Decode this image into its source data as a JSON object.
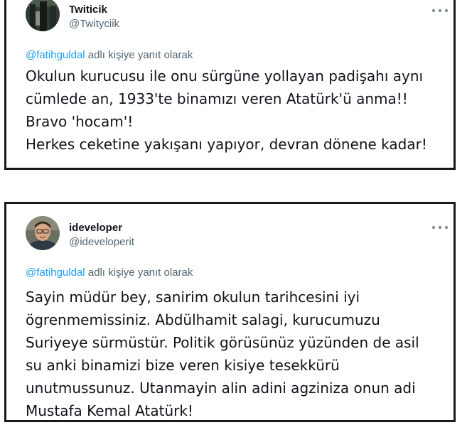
{
  "tweets": [
    {
      "display_name": "Twiticik",
      "handle": "@Twityciik",
      "reply": {
        "mention": "@fatihguldal",
        "suffix": " adlı kişiye yanıt olarak"
      },
      "text": "Okulun kurucusu ile onu sürgüne yollayan padişahı aynı\ncümlede an, 1933'te binamızı veren Atatürk'ü anma!!\nBravo 'hocam'!\nHerkes ceketine yakışanı yapıyor, devran dönene kadar!"
    },
    {
      "display_name": "ideveloper",
      "handle": "@ideveloperit",
      "reply": {
        "mention": "@fatihguldal",
        "suffix": " adlı kişiye yanıt olarak"
      },
      "text": "Sayin müdür bey, sanirim okulun tarihcesini iyi\nögrenmemissiniz. Abdülhamit salagi, kurucumuzu\nSuriyeye sürmüstür. Politik görüsünüz yüzünden de asil\nsu anki binamizi bize veren kisiye tesekkürü\nunutmussunuz. Utanmayin alin adini agziniza onun adi\nMustafa Kemal Atatürk!"
    }
  ]
}
